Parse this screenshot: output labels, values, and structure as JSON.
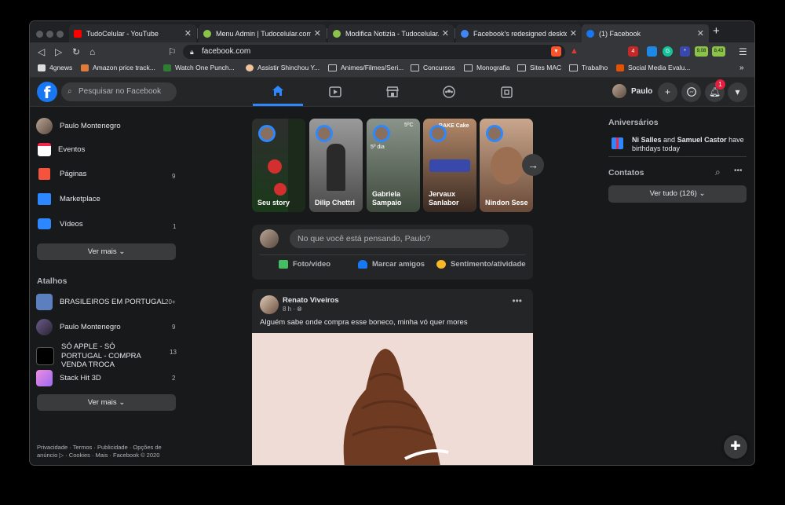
{
  "browser": {
    "tabs": [
      {
        "title": "TudoCelular - YouTube",
        "fav_color": "#ff0000"
      },
      {
        "title": "Menu Admin | Tudocelular.com",
        "fav_color": "#8bc34a"
      },
      {
        "title": "Modifica Notizia - Tudocelular.com",
        "fav_color": "#8bc34a"
      },
      {
        "title": "Facebook's redesigned desktop we",
        "fav_color": "#4285f4"
      },
      {
        "title": "(1) Facebook",
        "fav_color": "#1877f2"
      }
    ],
    "url": "facebook.com",
    "extensions": [
      {
        "label": "4",
        "color": "#c62828"
      },
      {
        "label": "",
        "color": "#1e88e5"
      },
      {
        "label": "G",
        "color": "#15c39a"
      },
      {
        "label": "*",
        "color": "#3949ab"
      },
      {
        "label": "9,08",
        "color": "#8bc34a"
      },
      {
        "label": "8,43",
        "color": "#8bc34a"
      }
    ],
    "bookmarks": [
      {
        "label": "4gnews",
        "icon": "site-icon"
      },
      {
        "label": "Amazon price track...",
        "icon": "site-icon"
      },
      {
        "label": "Watch One Punch...",
        "icon": "site-icon"
      },
      {
        "label": "Assistir Shinchou Y...",
        "icon": "site-icon"
      },
      {
        "label": "Animes/Filmes/Seri...",
        "icon": "folder-icon"
      },
      {
        "label": "Concursos",
        "icon": "folder-icon"
      },
      {
        "label": "Monografia",
        "icon": "folder-icon"
      },
      {
        "label": "Sites MAC",
        "icon": "folder-icon"
      },
      {
        "label": "Trabalho",
        "icon": "folder-icon"
      },
      {
        "label": "Social Media Evalu...",
        "icon": "site-icon"
      }
    ],
    "bookmarks_overflow": "»"
  },
  "fb": {
    "logo": "f",
    "search_placeholder": "Pesquisar no Facebook",
    "nav_icons": [
      "home-icon",
      "watch-icon",
      "marketplace-icon",
      "groups-icon",
      "gaming-icon"
    ],
    "profile_name": "Paulo",
    "notification_count": "1",
    "accent": "#2d88ff"
  },
  "left": {
    "items": [
      {
        "label": "Paulo Montenegro",
        "count": "",
        "color": "#8a6f5c"
      },
      {
        "label": "Eventos",
        "count": "",
        "color": "#f02849"
      },
      {
        "label": "Páginas",
        "count": "9",
        "color": "#f5533d"
      },
      {
        "label": "Marketplace",
        "count": "",
        "color": "#2d88ff"
      },
      {
        "label": "Vídeos",
        "count": "1",
        "color": "#2d88ff"
      }
    ],
    "see_more": "Ver mais",
    "shortcuts_title": "Atalhos",
    "shortcuts": [
      {
        "label": "BRASILEIROS EM PORTUGAL",
        "count": "20+",
        "color": "#5c7fbf"
      },
      {
        "label": "Paulo Montenegro",
        "count": "9",
        "color": "#6b5a8a"
      },
      {
        "label": "SÓ APPLE - SÓ PORTUGAL - COMPRA VENDA TROCA",
        "count": "13",
        "color": "#000000"
      },
      {
        "label": "Stack Hit 3D",
        "count": "2",
        "color": "#e98bd6"
      }
    ],
    "see_more_2": "Ver mais",
    "footer": "Privacidade · Termos · Publicidade · Opções de anúncio ▷ · Cookies · Mais · Facebook © 2020"
  },
  "stories": [
    {
      "name": "Seu story",
      "bg": "#2a3a2a"
    },
    {
      "name": "Dilip Chettri",
      "bg": "#6e6e6e"
    },
    {
      "name": "Gabriela Sampaio",
      "bg": "#4b5a48"
    },
    {
      "name": "Jervaux Sanlabor",
      "bg": "#6a4a3a"
    },
    {
      "name": "Nindon Sese",
      "bg": "#8a6a56"
    }
  ],
  "story_labels": {
    "gabriela_overlay": "5º dia",
    "gabriela_temp": "5ºC",
    "jervaux_overlay": "BAKE Cake"
  },
  "composer": {
    "placeholder": "No que você está pensando, Paulo?",
    "actions": [
      {
        "label": "Foto/vídeo",
        "color": "#45bd62"
      },
      {
        "label": "Marcar amigos",
        "color": "#1877f2"
      },
      {
        "label": "Sentimento/atividade",
        "color": "#f7b928"
      }
    ]
  },
  "post": {
    "author": "Renato Viveiros",
    "time": "8 h · ",
    "text": "Alguém sabe onde compra esse boneco, minha vó quer mores",
    "image_desc": "crochet-doll-photo"
  },
  "right": {
    "birthdays_title": "Aniversários",
    "birthday_name1": "Ni Salles",
    "birthday_and": " and ",
    "birthday_name2": "Samuel Castor",
    "birthday_suffix": " have birthdays today",
    "contacts_title": "Contatos",
    "see_all": "Ver tudo (126)"
  }
}
